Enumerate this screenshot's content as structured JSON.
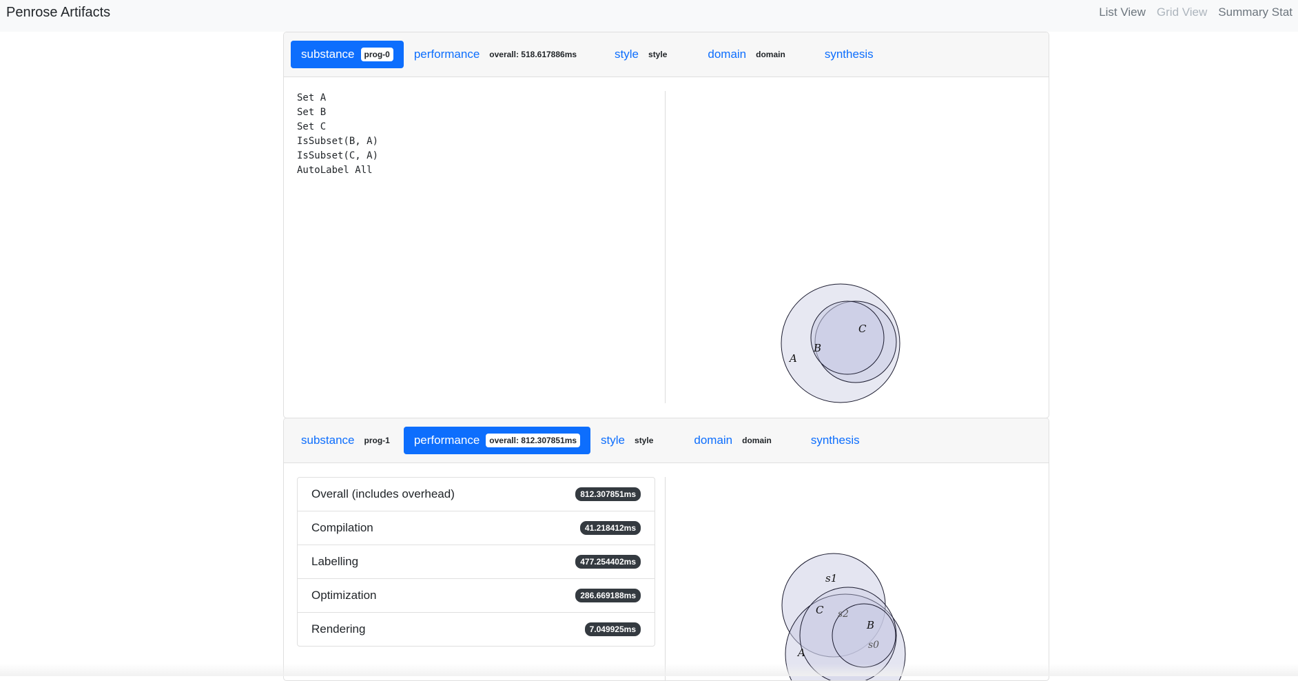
{
  "navbar": {
    "brand": "Penrose Artifacts",
    "links": [
      {
        "label": "List View",
        "disabled": false
      },
      {
        "label": "Grid View",
        "disabled": true
      },
      {
        "label": "Summary Stat",
        "disabled": false
      }
    ]
  },
  "cards": [
    {
      "tabs": [
        {
          "label": "substance",
          "badge": "prog-0",
          "active": true
        },
        {
          "label": "performance",
          "badge": "overall: 518.617886ms",
          "active": false
        },
        {
          "label": "style",
          "badge": "style",
          "active": false
        },
        {
          "label": "domain",
          "badge": "domain",
          "active": false
        },
        {
          "label": "synthesis",
          "badge": "",
          "active": false
        }
      ],
      "code_lines": [
        "Set A",
        "Set B",
        "Set C",
        "IsSubset(B, A)",
        "IsSubset(C, A)",
        "AutoLabel All"
      ],
      "diagram_labels": {
        "a": "A",
        "b": "B",
        "c": "C"
      }
    },
    {
      "tabs": [
        {
          "label": "substance",
          "badge": "prog-1",
          "active": false
        },
        {
          "label": "performance",
          "badge": "overall: 812.307851ms",
          "active": true
        },
        {
          "label": "style",
          "badge": "style",
          "active": false
        },
        {
          "label": "domain",
          "badge": "domain",
          "active": false
        },
        {
          "label": "synthesis",
          "badge": "",
          "active": false
        }
      ],
      "perf_rows": [
        {
          "label": "Overall (includes overhead)",
          "value": "812.307851ms"
        },
        {
          "label": "Compilation",
          "value": "41.218412ms"
        },
        {
          "label": "Labelling",
          "value": "477.254402ms"
        },
        {
          "label": "Optimization",
          "value": "286.669188ms"
        },
        {
          "label": "Rendering",
          "value": "7.049925ms"
        }
      ],
      "diagram_labels": {
        "s1": "s1",
        "c": "C",
        "s2": "s2",
        "b": "B",
        "a": "A",
        "s0": "s0"
      }
    }
  ],
  "colors": {
    "accent": "#0d6efd",
    "set_fill": "#c9cbe3",
    "badge_dark": "#343a40"
  }
}
